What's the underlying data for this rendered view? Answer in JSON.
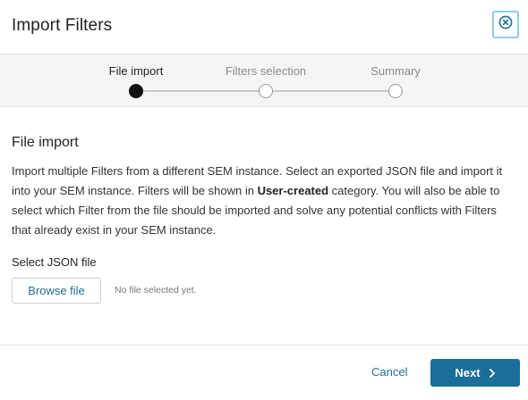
{
  "dialog": {
    "title": "Import Filters",
    "close_icon": "close-circle-icon"
  },
  "stepper": {
    "steps": [
      {
        "label": "File import",
        "state": "active"
      },
      {
        "label": "Filters selection",
        "state": "inactive"
      },
      {
        "label": "Summary",
        "state": "inactive"
      }
    ]
  },
  "content": {
    "section_title": "File import",
    "description_before": "Import multiple Filters from a different SEM instance. Select an exported JSON file and import it into your SEM instance. Filters will be shown in ",
    "description_bold": "User-created",
    "description_after": " category. You will also be able to select which Filter from the file should be imported and solve any potential conflicts with Filters that already exist in your SEM instance.",
    "file_label": "Select JSON file",
    "browse_label": "Browse file",
    "no_file_text": "No file selected yet."
  },
  "footer": {
    "cancel_label": "Cancel",
    "next_label": "Next",
    "next_icon": "chevron-right-icon"
  },
  "colors": {
    "accent": "#1a6e9a",
    "link": "#1f6e96",
    "close_border": "#8fd0e0",
    "stepper_bg": "#f5f5f5"
  }
}
